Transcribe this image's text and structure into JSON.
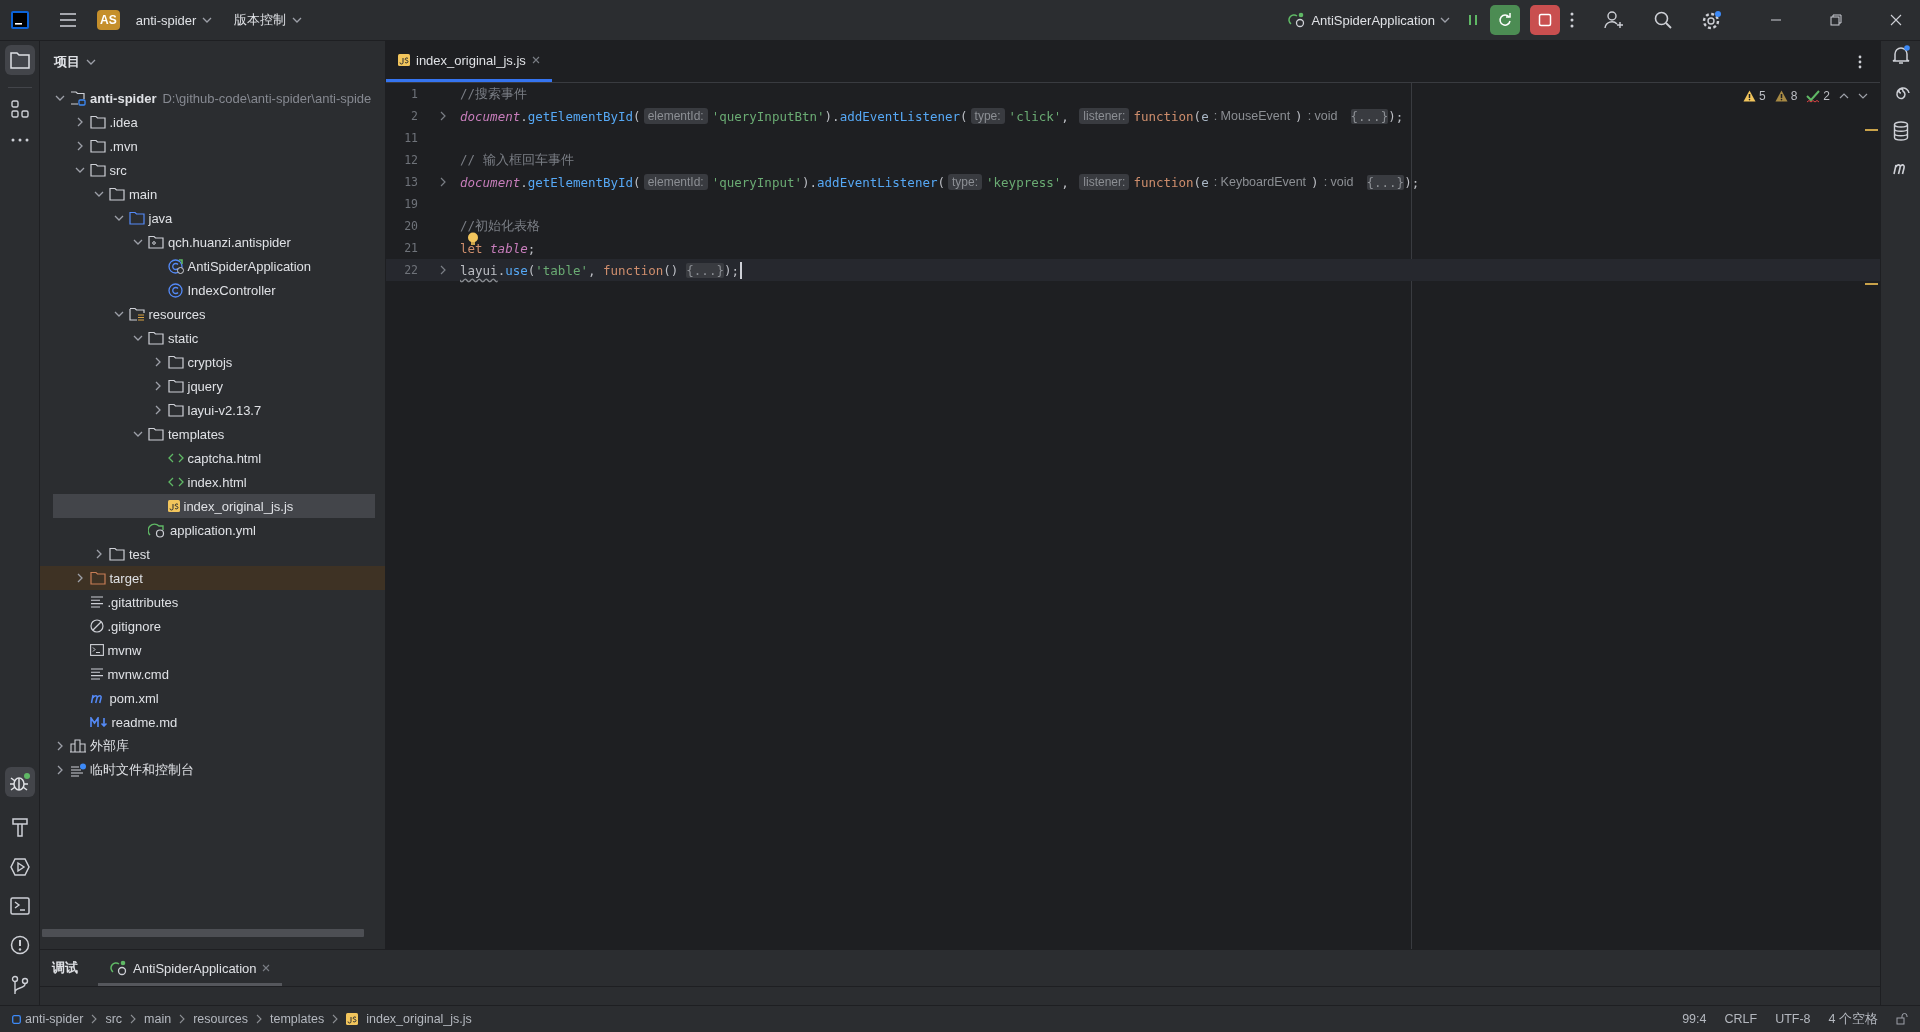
{
  "titlebar": {
    "project_badge": "AS",
    "project": "anti-spider",
    "vcs": "版本控制",
    "run_config": "AntiSpiderApplication"
  },
  "project": {
    "title": "项目",
    "tree": [
      {
        "label": "anti-spider",
        "path": "D:\\github-code\\anti-spider\\anti-spide",
        "kind": "module",
        "expanded": true,
        "selected": false,
        "children": [
          {
            "label": ".idea",
            "kind": "folder",
            "expanded": false,
            "selected": false
          },
          {
            "label": ".mvn",
            "kind": "folder",
            "expanded": false,
            "selected": false
          },
          {
            "label": "src",
            "kind": "folder",
            "expanded": true,
            "selected": false,
            "children": [
              {
                "label": "main",
                "kind": "folder",
                "expanded": true,
                "selected": false,
                "children": [
                  {
                    "label": "java",
                    "kind": "source-folder",
                    "expanded": true,
                    "selected": false,
                    "children": [
                      {
                        "label": "qch.huanzi.antispider",
                        "kind": "package",
                        "expanded": true,
                        "selected": false,
                        "children": [
                          {
                            "label": "AntiSpiderApplication",
                            "kind": "spring-class",
                            "selected": false
                          },
                          {
                            "label": "IndexController",
                            "kind": "class",
                            "selected": false
                          }
                        ]
                      }
                    ]
                  },
                  {
                    "label": "resources",
                    "kind": "resources-folder",
                    "expanded": true,
                    "selected": false,
                    "children": [
                      {
                        "label": "static",
                        "kind": "folder",
                        "expanded": true,
                        "selected": false,
                        "children": [
                          {
                            "label": "cryptojs",
                            "kind": "folder",
                            "expanded": false,
                            "selected": false
                          },
                          {
                            "label": "jquery",
                            "kind": "folder",
                            "expanded": false,
                            "selected": false
                          },
                          {
                            "label": "layui-v2.13.7",
                            "kind": "folder",
                            "expanded": false,
                            "selected": false
                          }
                        ]
                      },
                      {
                        "label": "templates",
                        "kind": "folder",
                        "expanded": true,
                        "selected": false,
                        "children": [
                          {
                            "label": "captcha.html",
                            "kind": "html",
                            "selected": false
                          },
                          {
                            "label": "index.html",
                            "kind": "html",
                            "selected": false
                          },
                          {
                            "label": "index_original_js.js",
                            "kind": "js",
                            "selected": true
                          }
                        ]
                      },
                      {
                        "label": "application.yml",
                        "kind": "spring-config",
                        "selected": false
                      }
                    ]
                  }
                ]
              },
              {
                "label": "test",
                "kind": "folder",
                "expanded": false,
                "selected": false
              }
            ]
          },
          {
            "label": "target",
            "kind": "excluded-folder",
            "expanded": false,
            "selected": false
          },
          {
            "label": ".gitattributes",
            "kind": "text",
            "selected": false
          },
          {
            "label": ".gitignore",
            "kind": "ignore",
            "selected": false
          },
          {
            "label": "mvnw",
            "kind": "terminal",
            "selected": false
          },
          {
            "label": "mvnw.cmd",
            "kind": "text",
            "selected": false
          },
          {
            "label": "pom.xml",
            "kind": "maven",
            "selected": false
          },
          {
            "label": "readme.md",
            "kind": "markdown",
            "selected": false
          }
        ]
      },
      {
        "label": "外部库",
        "kind": "library",
        "expanded": false,
        "selected": false
      },
      {
        "label": "临时文件和控制台",
        "kind": "scratch",
        "expanded": false,
        "selected": false
      }
    ]
  },
  "editor": {
    "tabs": [
      {
        "label": "index_original_js.js",
        "selected": true
      }
    ],
    "inspections": [
      {
        "kind": "warning",
        "count": "5"
      },
      {
        "kind": "weak-warning",
        "count": "8"
      },
      {
        "kind": "typo",
        "count": "2"
      }
    ],
    "lines": [
      {
        "number": "1",
        "foldable": false,
        "current": false,
        "tokens": [
          {
            "kind": "comment",
            "text": "//搜索事件"
          }
        ]
      },
      {
        "number": "2",
        "foldable": true,
        "current": false,
        "tokens": [
          {
            "kind": "global",
            "text": "document"
          },
          {
            "kind": "punct",
            "text": "."
          },
          {
            "kind": "method",
            "text": "getElementById"
          },
          {
            "kind": "punct",
            "text": "("
          },
          {
            "kind": "hint",
            "text": "elementId:"
          },
          {
            "kind": "string",
            "text": "'queryInputBtn'"
          },
          {
            "kind": "punct",
            "text": ")."
          },
          {
            "kind": "method",
            "text": "addEventListener"
          },
          {
            "kind": "punct",
            "text": "("
          },
          {
            "kind": "hint",
            "text": "type:"
          },
          {
            "kind": "string",
            "text": "'click'"
          },
          {
            "kind": "punct",
            "text": ", "
          },
          {
            "kind": "hint",
            "text": "listener:"
          },
          {
            "kind": "keyword",
            "text": "function"
          },
          {
            "kind": "punct",
            "text": "("
          },
          {
            "kind": "param",
            "text": "e"
          },
          {
            "kind": "typehint",
            "text": ": MouseEvent"
          },
          {
            "kind": "punct",
            "text": ")"
          },
          {
            "kind": "typehint",
            "text": ": void"
          },
          {
            "kind": "fold",
            "text": "{...}"
          },
          {
            "kind": "punct",
            "text": ");"
          }
        ]
      },
      {
        "number": "11",
        "foldable": false,
        "current": false
      },
      {
        "number": "12",
        "foldable": false,
        "current": false,
        "tokens": [
          {
            "kind": "comment",
            "text": "// 输入框回车事件"
          }
        ]
      },
      {
        "number": "13",
        "foldable": true,
        "current": false,
        "tokens": [
          {
            "kind": "global",
            "text": "document"
          },
          {
            "kind": "punct",
            "text": "."
          },
          {
            "kind": "method",
            "text": "getElementById"
          },
          {
            "kind": "punct",
            "text": "("
          },
          {
            "kind": "hint",
            "text": "elementId:"
          },
          {
            "kind": "string",
            "text": "'queryInput'"
          },
          {
            "kind": "punct",
            "text": ")."
          },
          {
            "kind": "method",
            "text": "addEventListener"
          },
          {
            "kind": "punct",
            "text": "("
          },
          {
            "kind": "hint",
            "text": "type:"
          },
          {
            "kind": "string",
            "text": "'keypress'"
          },
          {
            "kind": "punct",
            "text": ", "
          },
          {
            "kind": "hint",
            "text": "listener:"
          },
          {
            "kind": "keyword",
            "text": "function"
          },
          {
            "kind": "punct",
            "text": "("
          },
          {
            "kind": "param",
            "text": "e"
          },
          {
            "kind": "typehint",
            "text": ": KeyboardEvent"
          },
          {
            "kind": "punct",
            "text": ")"
          },
          {
            "kind": "typehint",
            "text": ": void"
          },
          {
            "kind": "fold",
            "text": "{...}"
          },
          {
            "kind": "punct",
            "text": ");"
          }
        ]
      },
      {
        "number": "19",
        "foldable": false,
        "current": false
      },
      {
        "number": "20",
        "foldable": false,
        "current": false,
        "tokens": [
          {
            "kind": "comment",
            "text": "//初始化表格"
          }
        ]
      },
      {
        "number": "21",
        "foldable": false,
        "current": false,
        "bulb": true,
        "tokens": [
          {
            "kind": "keyword",
            "text": "let"
          },
          {
            "kind": "local",
            "text": "table"
          },
          {
            "kind": "punct",
            "text": ";"
          }
        ]
      },
      {
        "number": "22",
        "foldable": true,
        "current": true,
        "caret": true,
        "tokens": [
          {
            "kind": "unresolved",
            "text": "layui"
          },
          {
            "kind": "punct",
            "text": "."
          },
          {
            "kind": "method",
            "text": "use"
          },
          {
            "kind": "punct",
            "text": "("
          },
          {
            "kind": "string",
            "text": "'table'"
          },
          {
            "kind": "punct",
            "text": ", "
          },
          {
            "kind": "keyword",
            "text": "function"
          },
          {
            "kind": "punct",
            "text": "()"
          },
          {
            "kind": "fold",
            "text": "{...}"
          },
          {
            "kind": "punct",
            "text": ");"
          }
        ]
      }
    ]
  },
  "bottom": {
    "title": "调试",
    "tabs": [
      {
        "label": "AntiSpiderApplication",
        "selected": true
      }
    ]
  },
  "breadcrumbs": [
    {
      "label": "anti-spider",
      "kind": "module"
    },
    {
      "label": "src",
      "kind": "folder"
    },
    {
      "label": "main",
      "kind": "folder"
    },
    {
      "label": "resources",
      "kind": "folder"
    },
    {
      "label": "templates",
      "kind": "folder"
    },
    {
      "label": "index_original_js.js",
      "kind": "js"
    }
  ],
  "status": [
    "99:4",
    "CRLF",
    "UTF-8",
    "4 个空格"
  ]
}
